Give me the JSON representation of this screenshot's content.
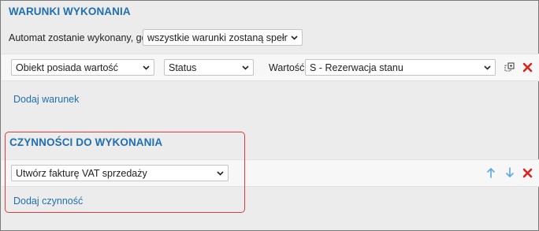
{
  "conditions": {
    "title": "WARUNKI WYKONANIA",
    "automat_label": "Automat zostanie wykonany, gdy",
    "automat_select": "wszystkie warunki zostaną spełnione",
    "rule": {
      "field_select": "Obiekt posiada wartość",
      "attribute_select": "Status",
      "value_label": "Wartość:",
      "value_select": "S - Rezerwacja stanu"
    },
    "add_link": "Dodaj warunek"
  },
  "actions": {
    "title": "CZYNNOŚCI DO WYKONANIA",
    "action_select": "Utwórz fakturę VAT sprzedaży",
    "add_link": "Dodaj czynność"
  },
  "colors": {
    "accent": "#1f6fb2",
    "delete": "#d9221c",
    "highlight": "#e23b3b",
    "arrow": "#5aa9e0"
  },
  "icons": {
    "chevron": "chevron-down-icon",
    "clone": "clone-icon",
    "delete": "close-icon",
    "up": "arrow-up-icon",
    "down": "arrow-down-icon"
  }
}
